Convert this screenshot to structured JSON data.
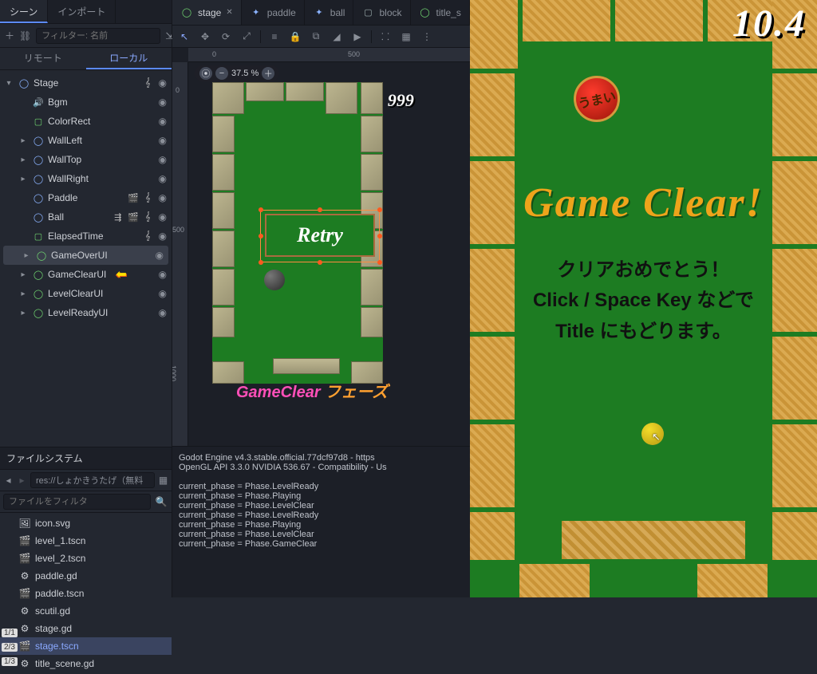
{
  "scene_panel": {
    "tab_scene": "シーン",
    "tab_import": "インポート",
    "filter_placeholder": "フィルター: 名前",
    "subtab_remote": "リモート",
    "subtab_local": "ローカル",
    "nodes": [
      {
        "indent": 0,
        "name": "Stage",
        "icon": "node2d",
        "arrow": "down",
        "extras": "script",
        "eye": true
      },
      {
        "indent": 1,
        "name": "Bgm",
        "icon": "audio",
        "eye": true
      },
      {
        "indent": 1,
        "name": "ColorRect",
        "icon": "rect",
        "eye": true
      },
      {
        "indent": 1,
        "name": "WallLeft",
        "icon": "node2d",
        "arrow": "right",
        "eye": true
      },
      {
        "indent": 1,
        "name": "WallTop",
        "icon": "node2d",
        "arrow": "right",
        "eye": true
      },
      {
        "indent": 1,
        "name": "WallRight",
        "icon": "node2d",
        "arrow": "right",
        "eye": true
      },
      {
        "indent": 1,
        "name": "Paddle",
        "icon": "node2d",
        "extras": "clip script",
        "eye": true
      },
      {
        "indent": 1,
        "name": "Ball",
        "icon": "node2d",
        "extras": "signal clip script",
        "eye": true
      },
      {
        "indent": 1,
        "name": "ElapsedTime",
        "icon": "rect",
        "extras": "script",
        "eye": true
      },
      {
        "indent": 1,
        "name": "GameOverUI",
        "icon": "control",
        "arrow": "right",
        "eye": true,
        "selected": true
      },
      {
        "indent": 1,
        "name": "GameClearUI",
        "icon": "control",
        "arrow": "right",
        "eye": true,
        "anno_arrow": true
      },
      {
        "indent": 1,
        "name": "LevelClearUI",
        "icon": "control",
        "arrow": "right",
        "eye": true
      },
      {
        "indent": 1,
        "name": "LevelReadyUI",
        "icon": "control",
        "arrow": "right",
        "eye": true
      }
    ]
  },
  "filesystem": {
    "title": "ファイルシステム",
    "path": "res://しょかきうたげ（無料",
    "filter_placeholder": "ファイルをフィルタ",
    "items": [
      {
        "name": "icon.svg",
        "icon": "img"
      },
      {
        "name": "level_1.tscn",
        "icon": "clap"
      },
      {
        "name": "level_2.tscn",
        "icon": "clap"
      },
      {
        "name": "paddle.gd",
        "icon": "gear"
      },
      {
        "name": "paddle.tscn",
        "icon": "clap"
      },
      {
        "name": "scutil.gd",
        "icon": "gear"
      },
      {
        "name": "stage.gd",
        "icon": "gear"
      },
      {
        "name": "stage.tscn",
        "icon": "clap",
        "selected": true
      },
      {
        "name": "title_scene.gd",
        "icon": "gear"
      }
    ],
    "counters": [
      "1/1",
      "2/3",
      "1/3"
    ]
  },
  "editor": {
    "tabs": [
      {
        "label": "stage",
        "icon": "control",
        "active": true,
        "close": true
      },
      {
        "label": "paddle",
        "icon": "node2d"
      },
      {
        "label": "ball",
        "icon": "node2d"
      },
      {
        "label": "block",
        "icon": "rect-outline"
      },
      {
        "label": "title_s",
        "icon": "control"
      }
    ],
    "ruler_h": [
      "0",
      "500"
    ],
    "ruler_v": [
      "0",
      "500",
      "1000"
    ],
    "zoom": "37.5 %",
    "score_in_canvas": "999",
    "retry_label": "Retry",
    "phase_text_1": "GameClear",
    "phase_text_2": " フェーズ"
  },
  "console": {
    "lines": [
      "Godot Engine v4.3.stable.official.77dcf97d8 - https",
      "OpenGL API 3.3.0 NVIDIA 536.67 - Compatibility - Us",
      " ",
      "current_phase = Phase.LevelReady",
      "current_phase = Phase.Playing",
      "current_phase = Phase.LevelClear",
      "current_phase = Phase.LevelReady",
      "current_phase = Phase.Playing",
      "current_phase = Phase.LevelClear",
      "current_phase = Phase.GameClear"
    ]
  },
  "game": {
    "timer": "10.4",
    "title": "Game Clear!",
    "msg_line1": "クリアおめでとう！",
    "msg_line2": "Click / Space Key などで",
    "msg_line3": "Title にもどります。",
    "token_text": "うまい"
  }
}
